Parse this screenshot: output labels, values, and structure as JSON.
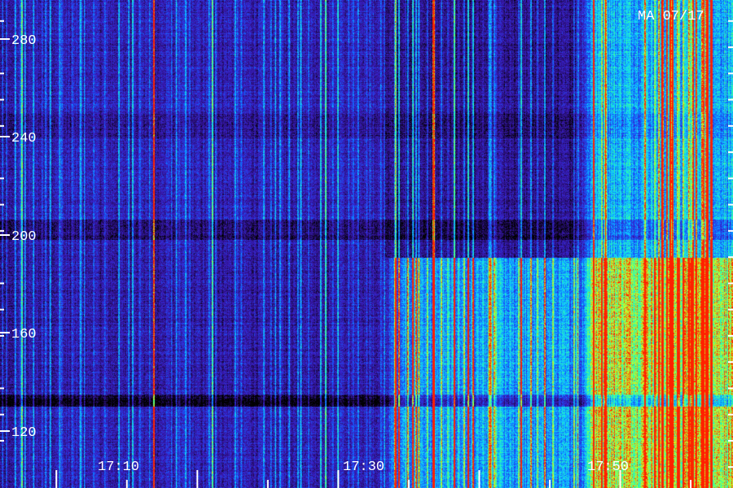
{
  "chart_data": {
    "type": "heatmap",
    "title": "MA 07/17",
    "xlabel": "",
    "ylabel": "",
    "x_range": [
      "17:06",
      "17:58"
    ],
    "x_tick_labels": [
      "17:10",
      "17:30",
      "17:50"
    ],
    "x_minor_tick_step_minutes": 5,
    "y_range": [
      112,
      298
    ],
    "y_tick_labels": [
      "120",
      "160",
      "200",
      "240",
      "280"
    ],
    "y_minor_tick_step": 10,
    "colormap": [
      "#000000",
      "#2a0f78",
      "#3a20c8",
      "#1060ff",
      "#10d0ff",
      "#30ffa0",
      "#d0ff20",
      "#ff2000"
    ],
    "grid": false,
    "regions": [
      {
        "description": "quiet background",
        "t_start": "17:06",
        "t_end": "17:33",
        "f_low": 112,
        "f_high": 298,
        "level": 0.25
      },
      {
        "description": "increasing activity",
        "t_start": "17:33",
        "t_end": "17:47",
        "f_low": 112,
        "f_high": 200,
        "level": 0.5
      },
      {
        "description": "strong burst",
        "t_start": "17:47",
        "t_end": "17:58",
        "f_low": 112,
        "f_high": 200,
        "level": 0.85
      },
      {
        "description": "burst extension",
        "t_start": "17:47",
        "t_end": "17:58",
        "f_low": 200,
        "f_high": 298,
        "level": 0.55
      }
    ]
  }
}
